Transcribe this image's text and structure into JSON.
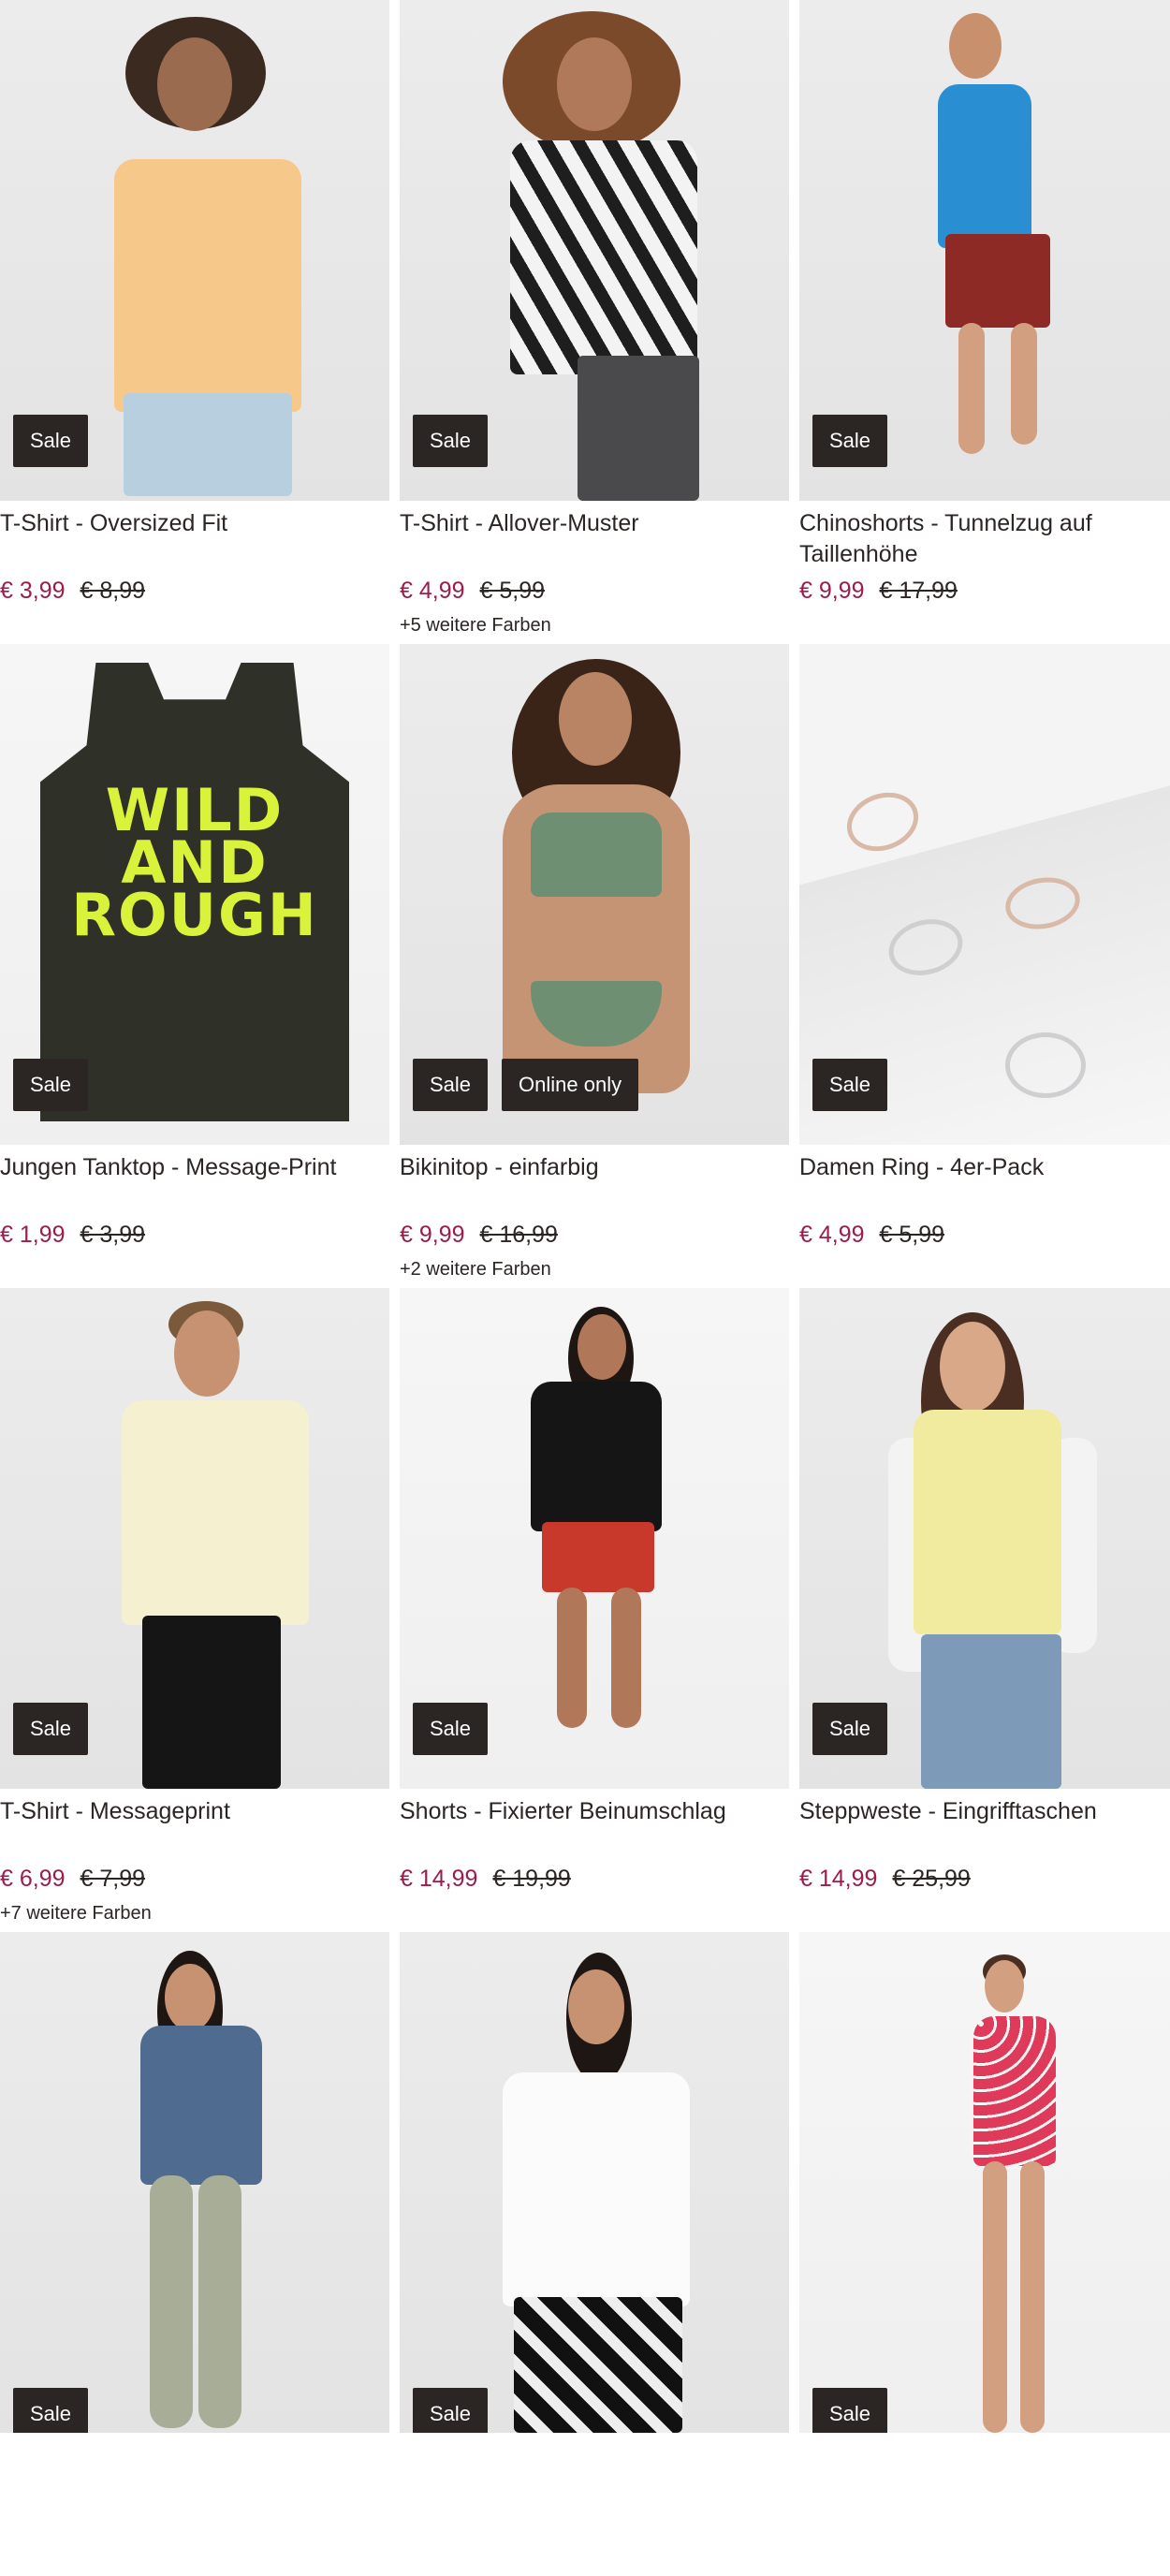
{
  "products": [
    {
      "name": "T-Shirt - Oversized Fit",
      "price": "€ 3,99",
      "old_price": "€ 8,99",
      "colors": "",
      "badges": [
        "Sale"
      ]
    },
    {
      "name": "T-Shirt - Allover-Muster",
      "price": "€ 4,99",
      "old_price": "€ 5,99",
      "colors": "+5 weitere Farben",
      "badges": [
        "Sale"
      ]
    },
    {
      "name": "Chinoshorts - Tunnelzug auf Taillenhöhe",
      "price": "€ 9,99",
      "old_price": "€ 17,99",
      "colors": "",
      "badges": [
        "Sale"
      ]
    },
    {
      "name": "Jungen Tanktop - Message-Print",
      "price": "€ 1,99",
      "old_price": "€ 3,99",
      "colors": "",
      "badges": [
        "Sale"
      ],
      "print": "WILD AND ROUGH"
    },
    {
      "name": "Bikinitop - einfarbig",
      "price": "€ 9,99",
      "old_price": "€ 16,99",
      "colors": "+2 weitere Farben",
      "badges": [
        "Sale",
        "Online only"
      ]
    },
    {
      "name": "Damen Ring - 4er-Pack",
      "price": "€ 4,99",
      "old_price": "€ 5,99",
      "colors": "",
      "badges": [
        "Sale"
      ]
    },
    {
      "name": "T-Shirt - Messageprint",
      "price": "€ 6,99",
      "old_price": "€ 7,99",
      "colors": "+7 weitere Farben",
      "badges": [
        "Sale"
      ]
    },
    {
      "name": "Shorts - Fixierter Beinumschlag",
      "price": "€ 14,99",
      "old_price": "€ 19,99",
      "colors": "",
      "badges": [
        "Sale"
      ]
    },
    {
      "name": "Steppweste - Eingrifftaschen",
      "price": "€ 14,99",
      "old_price": "€ 25,99",
      "colors": "",
      "badges": [
        "Sale"
      ]
    },
    {
      "name": "",
      "price": "",
      "old_price": "",
      "colors": "",
      "badges": [
        "Sale"
      ]
    },
    {
      "name": "",
      "price": "",
      "old_price": "",
      "colors": "",
      "badges": [
        "Sale"
      ]
    },
    {
      "name": "",
      "price": "",
      "old_price": "",
      "colors": "",
      "badges": [
        "Sale"
      ]
    }
  ],
  "colors": {
    "sale_price": "#9b1d4b",
    "badge_bg": "#2b2524",
    "badge_text": "#ffffff",
    "text": "#2b2524"
  }
}
